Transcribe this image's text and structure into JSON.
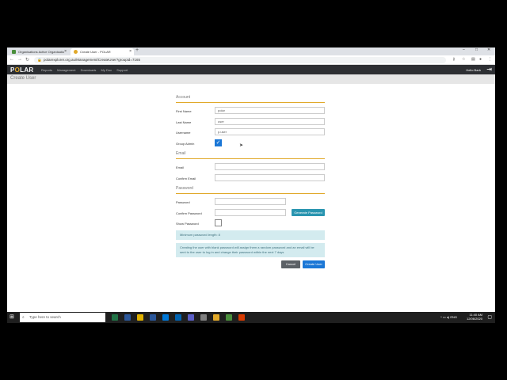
{
  "browser": {
    "tabs": [
      {
        "label": "Organisations Active Organisatio",
        "active": false,
        "color": "#4a8f3c"
      },
      {
        "label": "Create User - POLAR",
        "active": true,
        "color": "#e1a92a"
      }
    ],
    "url": "polarexplorer.org.au/Management/CreateUser?groupid=7165"
  },
  "app": {
    "logo_left": "P",
    "logo_o": "O",
    "logo_right": "LAR",
    "nav": [
      "Reports",
      "Management",
      "Downloads",
      "My Doc",
      "Support"
    ],
    "greeting": "Hello Barb",
    "page_title": "Create User"
  },
  "form": {
    "account": {
      "title": "Account",
      "first_name_label": "First Name",
      "first_name_value": "polar",
      "last_name_label": "Last Name",
      "last_name_value": "user",
      "username_label": "Username",
      "username_value": "p.user",
      "group_admin_label": "Group Admin",
      "group_admin_checked": true
    },
    "email": {
      "title": "Email",
      "email_label": "Email",
      "confirm_email_label": "Confirm Email"
    },
    "password": {
      "title": "Password",
      "password_label": "Password",
      "confirm_password_label": "Confirm Password",
      "generate_label": "Generate Password",
      "show_password_label": "Show Password",
      "min_length_note": "Minimum password length: 8",
      "blank_note": "Creating the user with blank password will assign them a random password and an email will be sent to the user to log in and change their password within the next 7 days"
    },
    "cancel_label": "Cancel",
    "create_label": "Create User"
  },
  "taskbar": {
    "search_placeholder": "Type here to search",
    "lang": "ENG",
    "time": "11:40 AM",
    "date": "12/06/2020",
    "icon_colors": [
      "#217346",
      "#2b579a",
      "#e1b200",
      "#2b579a",
      "#0078d7",
      "#0063b1",
      "#5b5fc7",
      "#7f7f7f",
      "#e1a92a",
      "#4a8f3c",
      "#d83b01"
    ]
  }
}
